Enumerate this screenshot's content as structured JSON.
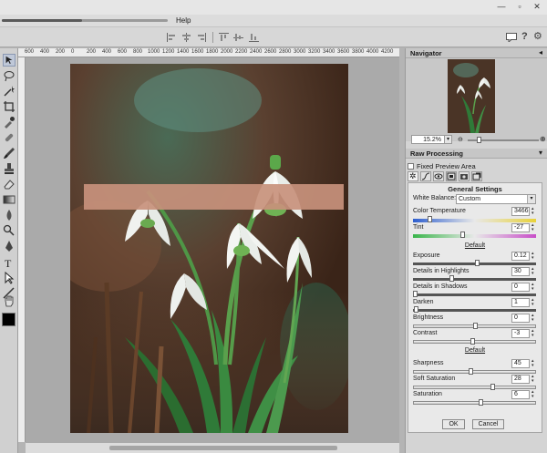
{
  "menu": {
    "help": "Help"
  },
  "rulers": [
    "600",
    "400",
    "200",
    "0",
    "200",
    "400",
    "600",
    "800",
    "1000",
    "1200",
    "1400",
    "1600",
    "1800",
    "2000",
    "2200",
    "2400",
    "2600",
    "2800",
    "3000",
    "3200",
    "3400",
    "3600",
    "3800",
    "4000",
    "4200"
  ],
  "navigator": {
    "title": "Navigator",
    "zoom": "15.2%"
  },
  "raw": {
    "title": "Raw Processing",
    "fixed_preview": "Fixed Preview Area",
    "general_settings": "General Settings",
    "white_balance_label": "White Balance:",
    "white_balance_value": "Custom",
    "default1": "Default",
    "default2": "Default",
    "ok": "OK",
    "cancel": "Cancel",
    "sliders": {
      "color_temperature": {
        "label": "Color Temperature",
        "value": "3466"
      },
      "tint": {
        "label": "Tint",
        "value": "-27"
      },
      "exposure": {
        "label": "Exposure",
        "value": "0.12"
      },
      "details_highlights": {
        "label": "Details in Highlights",
        "value": "30"
      },
      "details_shadows": {
        "label": "Details in Shadows",
        "value": "0"
      },
      "darken": {
        "label": "Darken",
        "value": "1"
      },
      "brightness": {
        "label": "Brightness",
        "value": "0"
      },
      "contrast": {
        "label": "Contrast",
        "value": "-3"
      },
      "sharpness": {
        "label": "Sharpness",
        "value": "45"
      },
      "soft_saturation": {
        "label": "Soft Saturation",
        "value": "28"
      },
      "saturation": {
        "label": "Saturation",
        "value": "6"
      }
    }
  },
  "colors": {
    "accent": "#3b6fb6",
    "tint_start": "#39b54a",
    "tint_end": "#c84fc8",
    "temp_start": "#2e5fcf",
    "temp_end": "#e8d23a"
  },
  "icons": [
    "minimize-icon",
    "restore-icon",
    "close-icon",
    "chat-icon",
    "help-icon",
    "settings-icon"
  ]
}
